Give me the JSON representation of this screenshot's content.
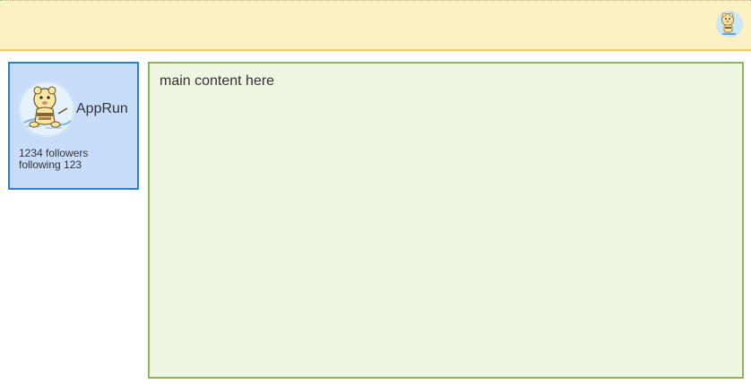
{
  "header": {
    "avatar_icon": "mascot-avatar-icon"
  },
  "sidebar": {
    "avatar_icon": "mascot-avatar-icon",
    "name": "AppRun",
    "followers": "1234 followers",
    "following": "following 123"
  },
  "main": {
    "content": "main content here"
  },
  "colors": {
    "header_bg": "#fdf0c2",
    "header_border": "#f2cd57",
    "sidebar_bg": "#c7ddf9",
    "sidebar_border": "#2f7ed4",
    "main_bg": "#eef5e3",
    "main_border": "#8fb25f"
  }
}
